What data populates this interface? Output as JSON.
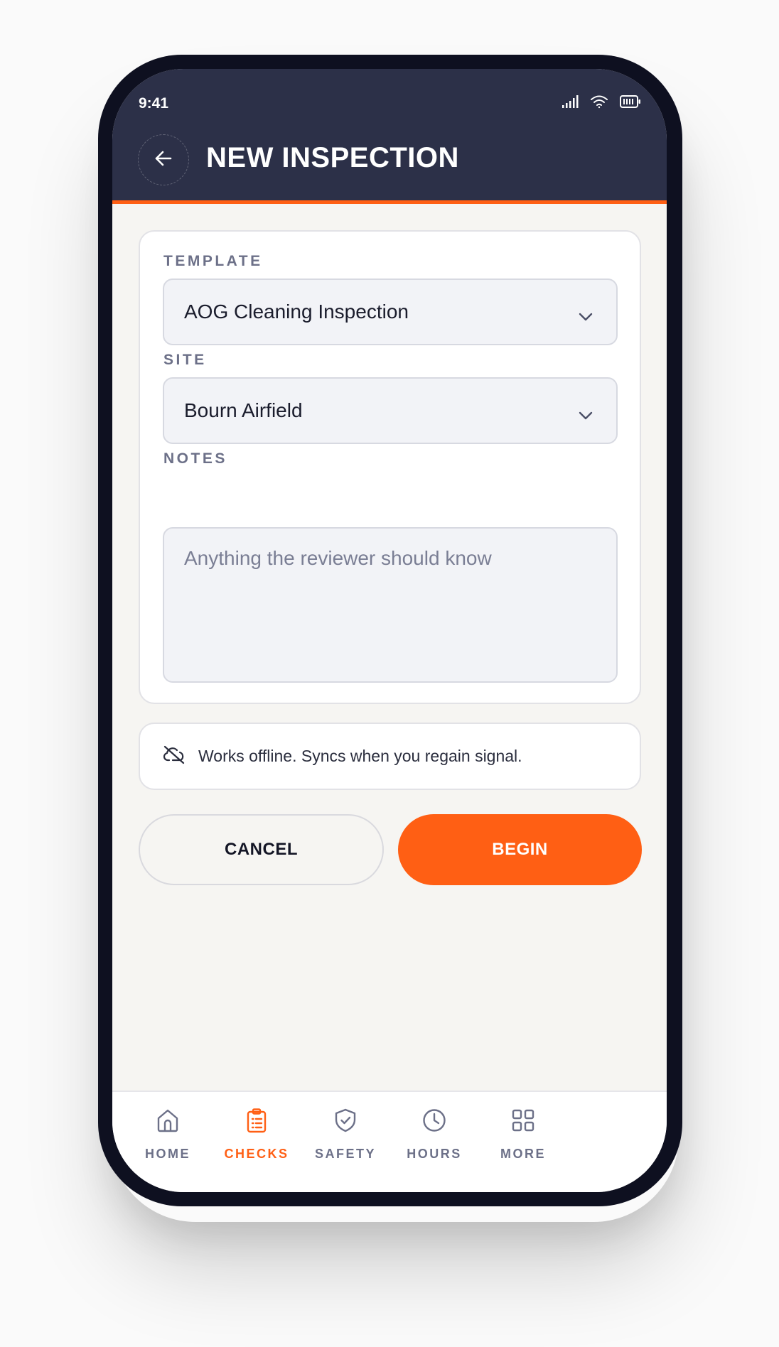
{
  "status_bar": {
    "time": "9:41"
  },
  "header": {
    "title": "NEW INSPECTION"
  },
  "form": {
    "template_label": "TEMPLATE",
    "template_value": "AOG Cleaning Inspection",
    "site_label": "SITE",
    "site_value": "Bourn Airfield",
    "notes_label": "NOTES",
    "notes_placeholder": "Anything the reviewer should know"
  },
  "notice": {
    "text": "Works offline. Syncs when you regain signal."
  },
  "actions": {
    "cancel_label": "CANCEL",
    "begin_label": "BEGIN"
  },
  "nav": {
    "items": [
      {
        "label": "HOME",
        "icon": "home-icon",
        "active": false
      },
      {
        "label": "CHECKS",
        "icon": "clipboard-icon",
        "active": true
      },
      {
        "label": "SAFETY",
        "icon": "shield-check-icon",
        "active": false
      },
      {
        "label": "HOURS",
        "icon": "clock-icon",
        "active": false
      },
      {
        "label": "MORE",
        "icon": "grid-icon",
        "active": false
      }
    ]
  },
  "colors": {
    "header_bg": "#2c3048",
    "accent": "#ff5f14",
    "screen_bg": "#f6f5f2",
    "muted_text": "#6c7088"
  }
}
